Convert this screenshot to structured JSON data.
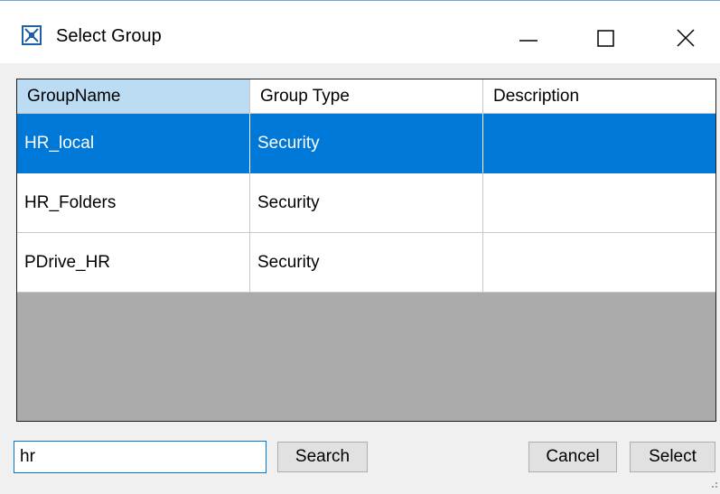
{
  "window": {
    "title": "Select Group",
    "icon": "app-window-icon",
    "controls": [
      "minimize-icon",
      "maximize-icon",
      "close-icon"
    ]
  },
  "grid": {
    "columns": [
      "GroupName",
      "Group Type",
      "Description"
    ],
    "sorted_column": "GroupName",
    "rows": [
      {
        "name": "HR_local",
        "type": "Security",
        "description": "",
        "selected": true
      },
      {
        "name": "HR_Folders",
        "type": "Security",
        "description": "",
        "selected": false
      },
      {
        "name": "PDrive_HR",
        "type": "Security",
        "description": "",
        "selected": false
      }
    ]
  },
  "search": {
    "value": "hr",
    "button_label": "Search"
  },
  "actions": {
    "cancel_label": "Cancel",
    "select_label": "Select"
  },
  "colors": {
    "selection": "#0078d7",
    "header_sorted": "#bcdcf4",
    "empty_area": "#ababab"
  }
}
